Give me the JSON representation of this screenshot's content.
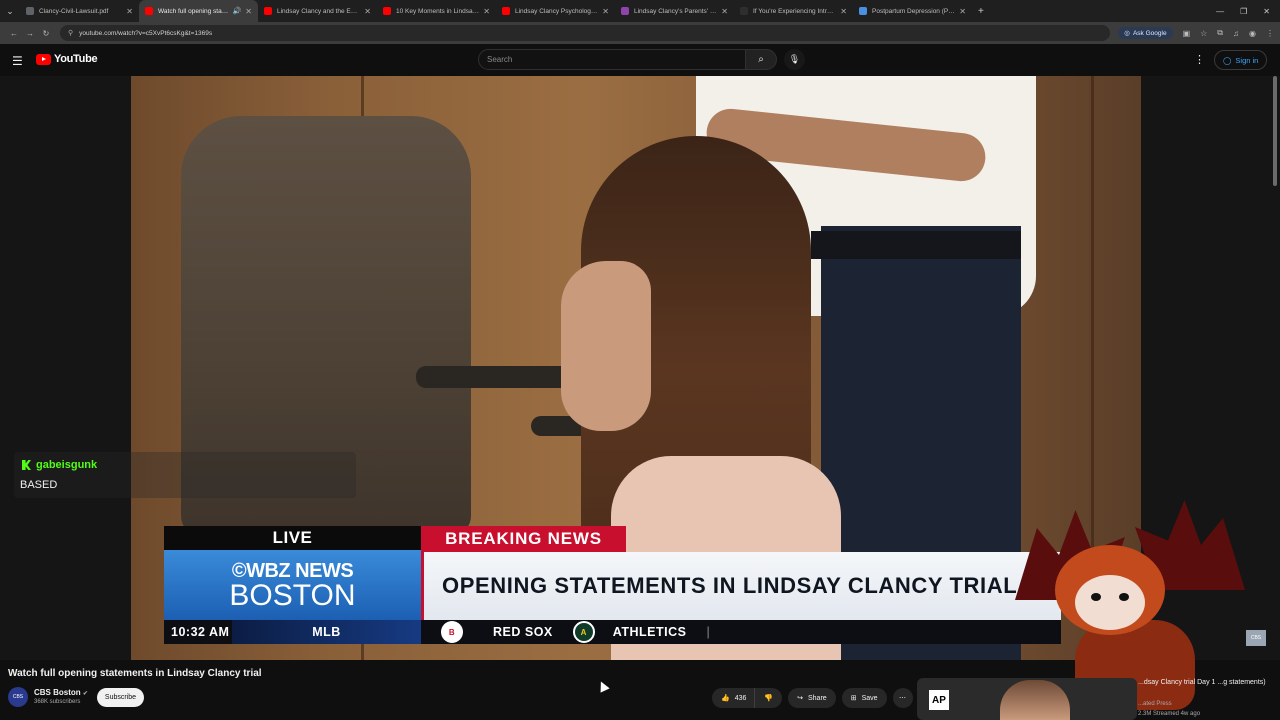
{
  "browser": {
    "tabs": [
      {
        "label": "Clancy-Civil-Lawsuit.pdf",
        "favicon_color": "#5f6368",
        "active": false
      },
      {
        "label": "Watch full opening stateme...",
        "favicon_color": "#ff0000",
        "active": true
      },
      {
        "label": "Lindsay Clancy and the Evidenc...",
        "favicon_color": "#ff0000",
        "active": false
      },
      {
        "label": "10 Key Moments in Lindsay Cla...",
        "favicon_color": "#ff0000",
        "active": false
      },
      {
        "label": "Lindsay Clancy Psychologist Dr...",
        "favicon_color": "#ff0000",
        "active": false
      },
      {
        "label": "Lindsay Clancy's Parents' $1 M...",
        "favicon_color": "#8e44ad",
        "active": false
      },
      {
        "label": "If You're Experiencing Intrusive...",
        "favicon_color": "#2e2e2e",
        "active": false
      },
      {
        "label": "Postpartum Depression (PPD): ...",
        "favicon_color": "#4a90e2",
        "active": false
      }
    ],
    "url": "youtube.com/watch?v=c5XvPt6csKg&t=1369s",
    "ask_google": "Ask Google"
  },
  "youtube": {
    "logo_text": "YouTube",
    "search_placeholder": "Search",
    "sign_in": "Sign in"
  },
  "overlay": {
    "live": "LIVE",
    "breaking": "BREAKING NEWS",
    "station_line1": "©WBZ NEWS",
    "station_line2": "BOSTON",
    "headline": "OPENING STATEMENTS IN LINDSAY CLANCY TRIAL",
    "ticker_time": "10:32 AM",
    "ticker_league": "MLB",
    "ticker_team1": "RED SOX",
    "ticker_team2": "ATHLETICS",
    "ticker_sep": "|"
  },
  "chat": {
    "username": "gabeisgunk",
    "message": "BASED"
  },
  "video_info": {
    "title": "Watch full opening statements in Lindsay Clancy trial",
    "channel": "CBS Boston",
    "avatar_text": "CBS",
    "subscribers": "368K subscribers",
    "subscribe": "Subscribe",
    "likes": "436",
    "share": "Share",
    "save": "Save"
  },
  "related": {
    "logo": "AP",
    "title": "...dsay Clancy trial Day 1 ...g statements)",
    "channel": "...ated Press",
    "meta": "2.3M  Streamed 4w ago"
  }
}
